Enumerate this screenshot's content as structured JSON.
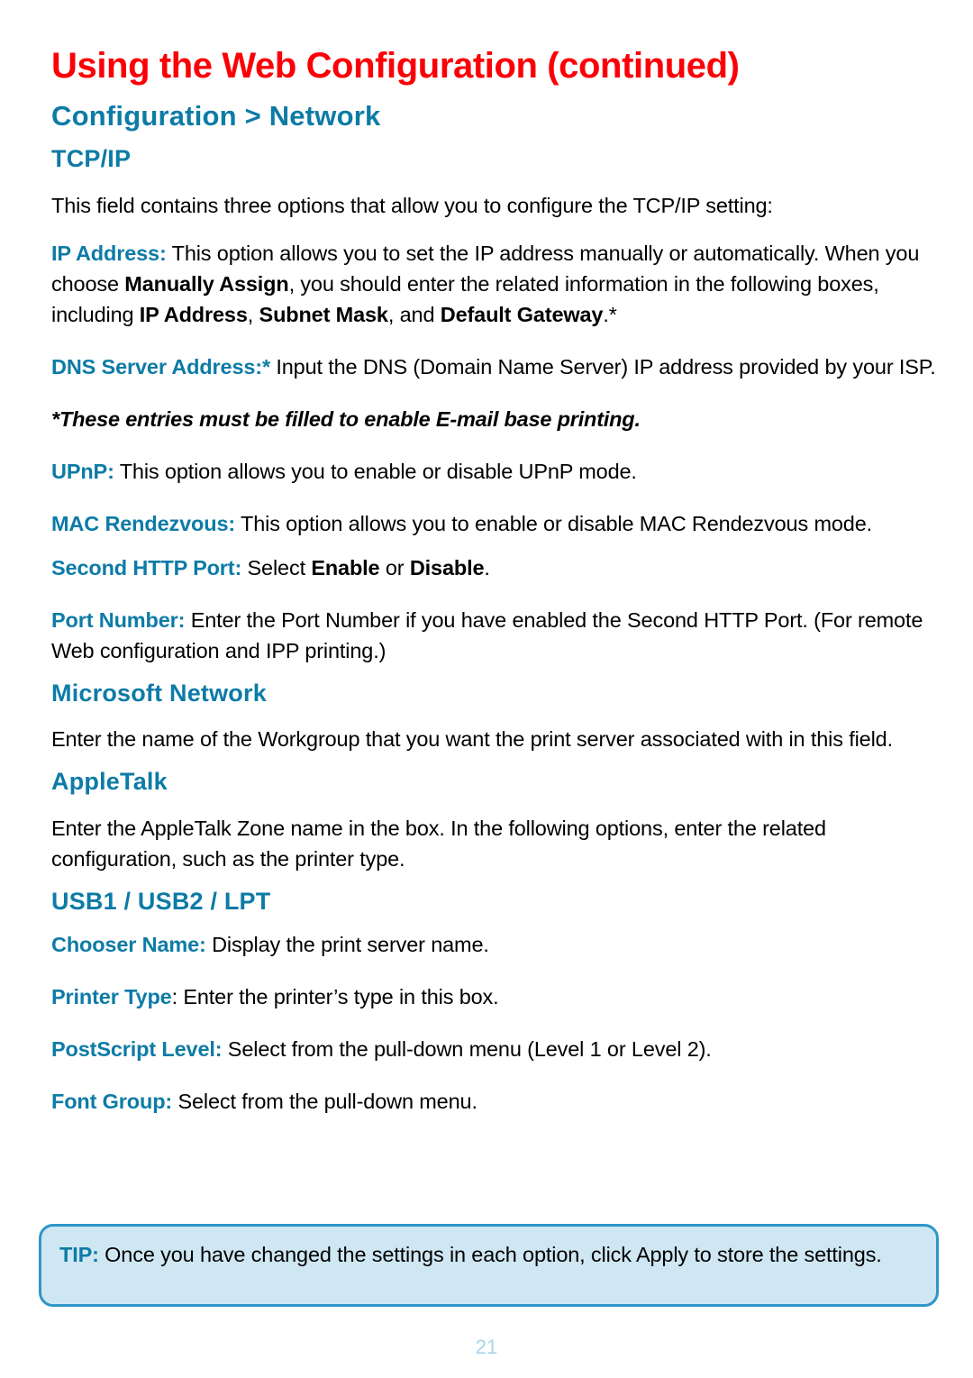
{
  "colors": {
    "title_red": "#fb0007",
    "heading_blue": "#0d7ba6",
    "tip_fill": "#cfe7f3",
    "tip_border": "#2e96c8",
    "page_number": "#a9d3ea"
  },
  "header": {
    "title": "Using the Web Configuration (continued)",
    "section": "Configuration > Network",
    "subsection": "TCP/IP"
  },
  "tcpip": {
    "intro": "This field contains three options that allow you to configure the TCP/IP setting:",
    "ip_address": {
      "label": "IP Address:",
      "text_1": " This option allows you to set the IP address manually or automatically. When you choose ",
      "bold_1": "Manually Assign",
      "text_2": ", you should enter the related information in the following boxes, including ",
      "bold_2": "IP Address",
      "text_3": ", ",
      "bold_3": "Subnet Mask",
      "text_4": ", and ",
      "bold_4": "Default Gateway",
      "text_5": ".*"
    },
    "dns": {
      "label": "DNS Server Address:*",
      "text": " Input the DNS (Domain Name Server) IP address provided by your ISP."
    },
    "footnote": "*These entries must be filled to enable E-mail base printing.",
    "upnp": {
      "label": "UPnP:",
      "text": " This option allows you to enable or disable UPnP mode."
    },
    "mac_rendezvous": {
      "label": "MAC Rendezvous:",
      "text": " This option allows you to enable or disable MAC Rendezvous mode."
    },
    "second_http_port": {
      "label": "Second HTTP Port:",
      "text_1": " Select ",
      "bold_1": "Enable",
      "text_2": " or ",
      "bold_2": "Disable",
      "text_3": "."
    },
    "port_number": {
      "label": "Port Number:",
      "text": " Enter the Port Number if you have enabled the Second HTTP Port. (For remote Web configuration and IPP printing.)"
    }
  },
  "microsoft_network": {
    "heading": "Microsoft Network",
    "body": "Enter the name of the Workgroup that you want the print server associated with in this field."
  },
  "appletalk": {
    "heading": "AppleTalk",
    "body": "Enter the AppleTalk Zone name in the box. In the following options, enter the related configuration, such as the printer type."
  },
  "usb_lpt": {
    "heading": "USB1 / USB2 / LPT",
    "chooser_name": {
      "label": "Chooser Name:",
      "text": " Display the print server name."
    },
    "printer_type": {
      "label": "Printer Type",
      "text": ": Enter the printer’s type in this box."
    },
    "postscript_level": {
      "label": "PostScript Level:",
      "text": " Select from the pull-down menu (Level 1 or Level 2)."
    },
    "font_group": {
      "label": "Font Group:",
      "text": " Select from the pull-down menu."
    }
  },
  "tip": {
    "label": "TIP:",
    "text": " Once you have changed the settings in each option, click Apply to store the settings."
  },
  "footer": {
    "page_number": "21"
  }
}
